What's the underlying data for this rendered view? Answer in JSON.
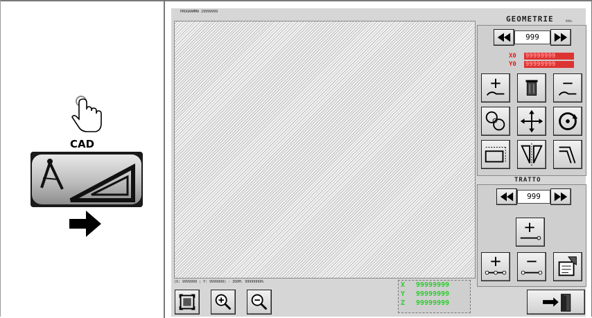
{
  "left": {
    "cad_label": "CAD"
  },
  "screen": {
    "program_label": "PROGRAMMA 29999999",
    "coord_label": "(X: 9999999 ; Y: 9999999) - ZOOM: 99999999%",
    "geometry": {
      "title": "GEOMETRIE",
      "small": "999s",
      "counter": "999",
      "x0_label": "X0",
      "y0_label": "Y0",
      "x0_value": "99999999",
      "y0_value": "99999999"
    },
    "tratto": {
      "title": "TRATTO",
      "counter": "999"
    },
    "readout": {
      "x_label": "X",
      "y_label": "Y",
      "z_label": "Z",
      "x_value": "99999999",
      "y_value": "99999999",
      "z_value": "99999999"
    }
  },
  "colors": {
    "readout_green": "#2ecc2e",
    "coord_red": "#dd3333"
  },
  "icons": [
    "pointer-hand-icon",
    "cad-tools-icon",
    "arrow-right-icon",
    "rewind-icon",
    "fast-forward-icon",
    "add-line-icon",
    "trash-icon",
    "edit-line-icon",
    "circles-icon",
    "move-icon",
    "rotate-icon",
    "rectangle-icon",
    "mirror-icon",
    "offset-icon",
    "add-segment-icon",
    "add-node-icon",
    "remove-node-icon",
    "save-icon",
    "fit-view-icon",
    "zoom-in-icon",
    "zoom-out-icon",
    "exit-door-icon"
  ]
}
